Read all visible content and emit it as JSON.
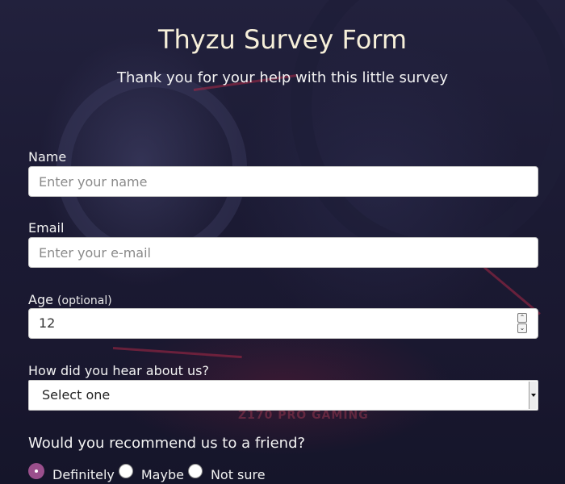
{
  "header": {
    "title": "Thyzu Survey Form",
    "subtitle": "Thank you for your help with this little survey"
  },
  "background": {
    "brand_text": "Z170 PRO GAMING"
  },
  "form": {
    "name": {
      "label": "Name",
      "placeholder": "Enter your name",
      "value": ""
    },
    "email": {
      "label": "Email",
      "placeholder": "Enter your e-mail",
      "value": ""
    },
    "age": {
      "label": "Age",
      "optional_note": "(optional)",
      "value": "12"
    },
    "referral": {
      "label": "How did you hear about us?",
      "selected": "Select one"
    },
    "recommend": {
      "question": "Would you recommend us to a friend?",
      "options": [
        {
          "label": "Definitely",
          "checked": true
        },
        {
          "label": "Maybe",
          "checked": false
        },
        {
          "label": "Not sure",
          "checked": false
        }
      ]
    }
  },
  "colors": {
    "accent": "#9a4f8c",
    "title": "#f6efd9",
    "text": "#f2f2f2",
    "background": "#1b1a33"
  }
}
